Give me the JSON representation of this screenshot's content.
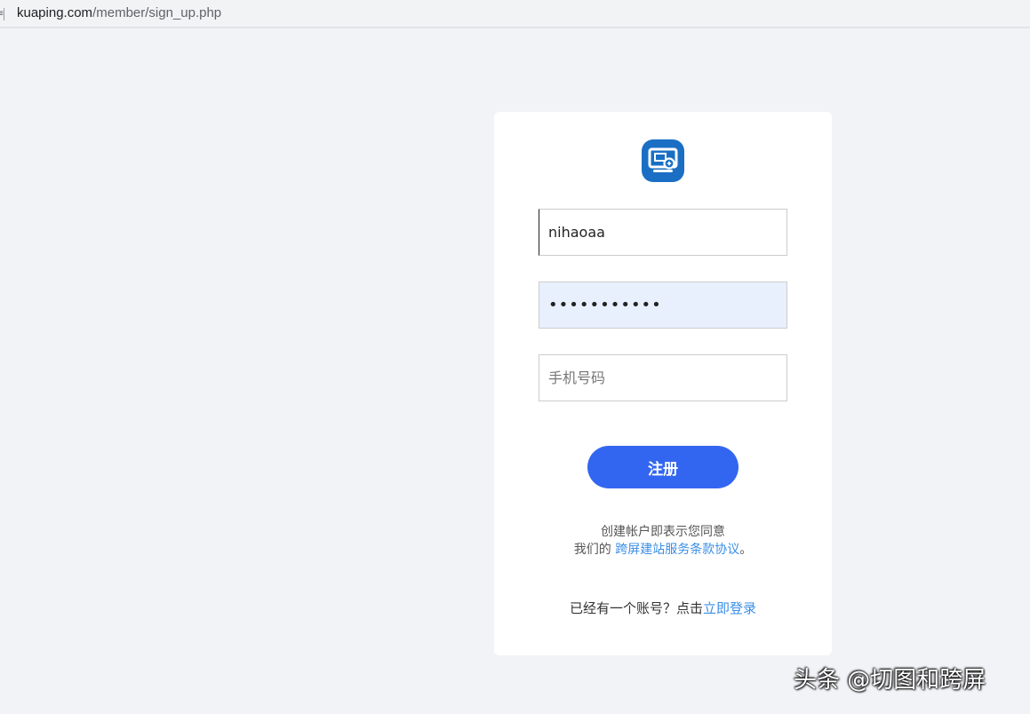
{
  "browser": {
    "url_host": "kuaping.com",
    "url_path": "/member/sign_up.php"
  },
  "form": {
    "username_value": "nihaoaa",
    "password_value": "***********",
    "phone_placeholder": "手机号码",
    "submit_label": "注册"
  },
  "agreement": {
    "line1": "创建帐户即表示您同意",
    "prefix": "我们的 ",
    "link": "跨屏建站服务条款协议",
    "suffix": "。"
  },
  "login_prompt": {
    "text": "已经有一个账号？点击",
    "link": "立即登录"
  },
  "watermark": {
    "text": "头条 @切图和跨屏"
  },
  "colors": {
    "page_bg": "#f2f3f7",
    "button": "#3366f0",
    "link": "#3a8ee6",
    "logo": "#1a6fc4"
  }
}
